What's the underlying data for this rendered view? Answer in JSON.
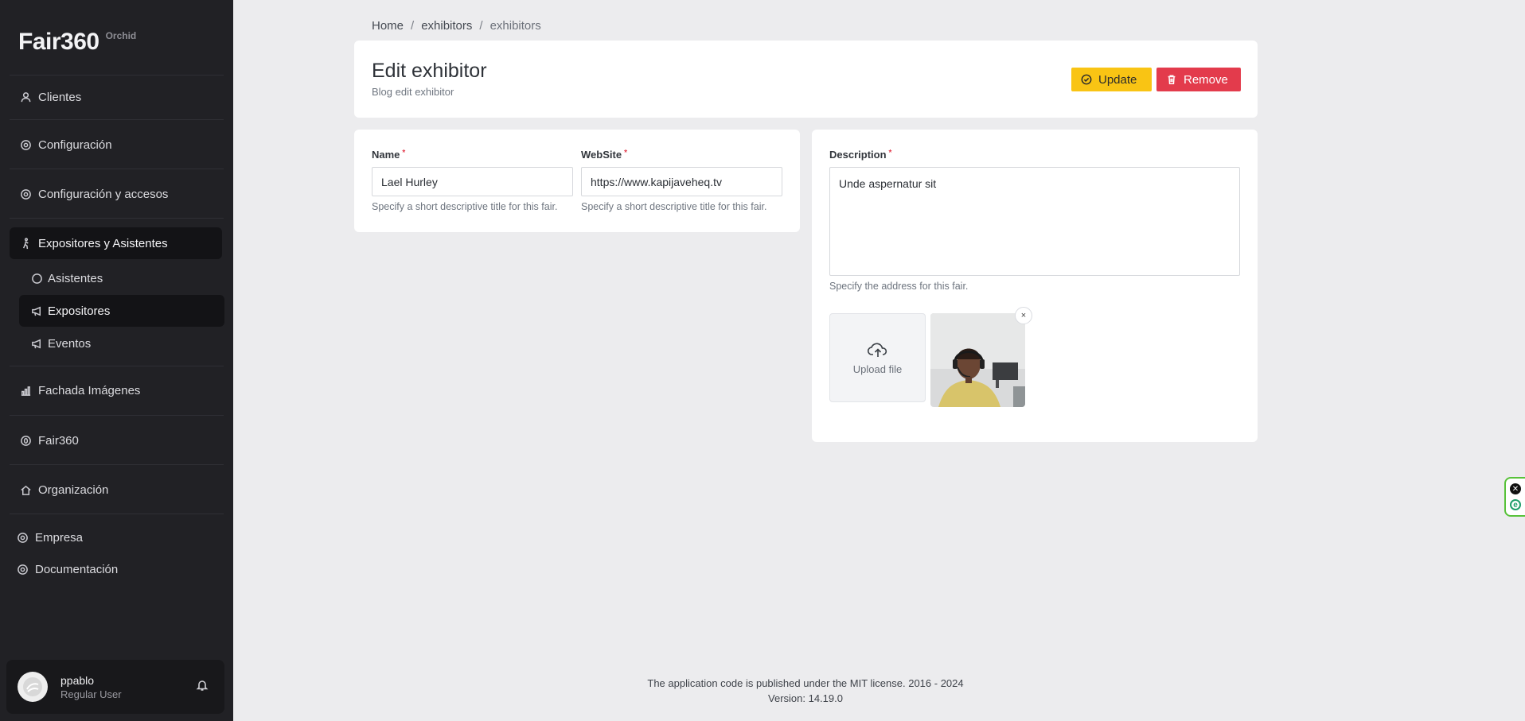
{
  "brand": {
    "name": "Fair360",
    "edition": "Orchid"
  },
  "sidebar": {
    "items": [
      {
        "label": "Clientes",
        "icon": "user-icon"
      },
      {
        "label": "Configuración",
        "icon": "gear-icon"
      },
      {
        "label": "Configuración y accesos",
        "icon": "gear-icon"
      },
      {
        "label": "Expositores y Asistentes",
        "icon": "person-walking-icon",
        "active": true
      },
      {
        "label": "Fachada Imágenes",
        "icon": "bar-chart-icon"
      },
      {
        "label": "Fair360",
        "icon": "circle-zero-icon"
      },
      {
        "label": "Organización",
        "icon": "house-icon"
      },
      {
        "label": "Empresa",
        "icon": "gear-icon"
      },
      {
        "label": "Documentación",
        "icon": "gear-icon"
      }
    ],
    "subitems": [
      {
        "label": "Asistentes",
        "icon": "circle-icon"
      },
      {
        "label": "Expositores",
        "icon": "megaphone-icon",
        "active": true
      },
      {
        "label": "Eventos",
        "icon": "megaphone-icon"
      }
    ]
  },
  "user": {
    "name": "ppablo",
    "role": "Regular User"
  },
  "breadcrumb": [
    "Home",
    "exhibitors",
    "exhibitors"
  ],
  "header": {
    "title": "Edit exhibitor",
    "subtitle": "Blog edit exhibitor",
    "update_label": "Update",
    "remove_label": "Remove"
  },
  "form": {
    "name": {
      "label": "Name",
      "value": "Lael Hurley",
      "help": "Specify a short descriptive title for this fair."
    },
    "website": {
      "label": "WebSite",
      "value": "https://www.kapijaveheq.tv",
      "help": "Specify a short descriptive title for this fair."
    },
    "description": {
      "label": "Description",
      "value": "Unde aspernatur sit",
      "help": "Specify the address for this fair."
    },
    "upload_label": "Upload file",
    "thumb_close": "×"
  },
  "footer": {
    "license": "The application code is published under the MIT license. 2016 - 2024",
    "version": "Version: 14.19.0"
  },
  "colors": {
    "sidebar": "#212125",
    "update": "#f9c414",
    "remove": "#e33b4c",
    "background": "#ececee"
  }
}
